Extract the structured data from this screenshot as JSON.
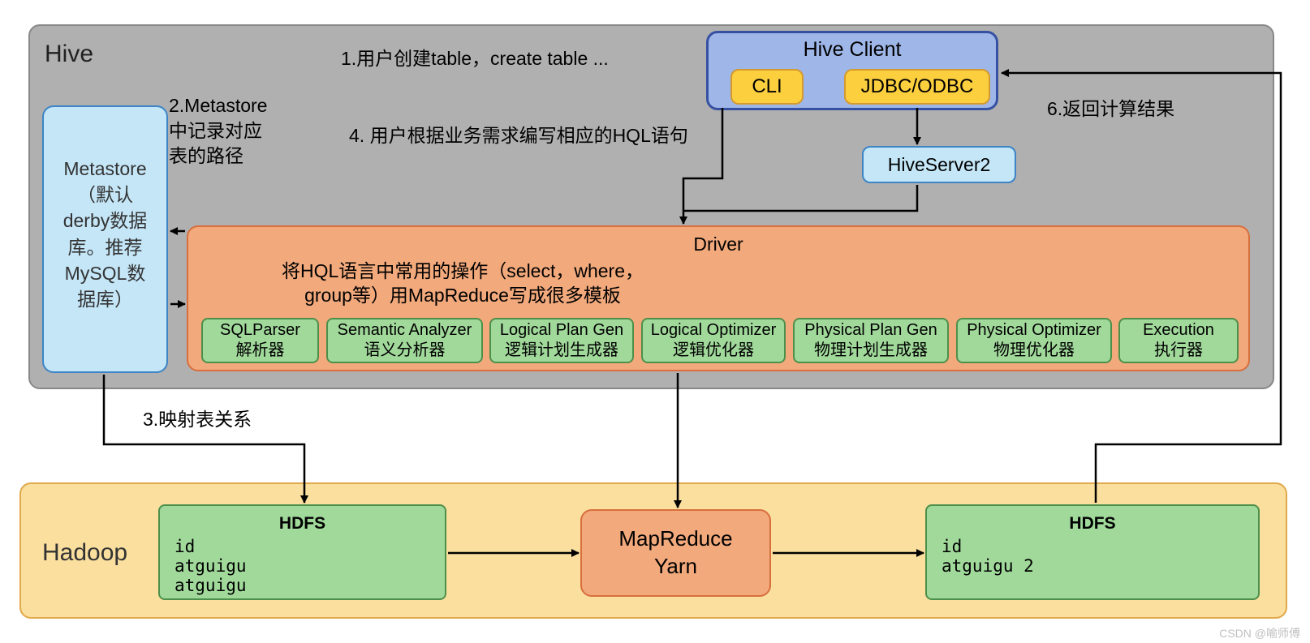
{
  "hive": {
    "title": "Hive",
    "step1": "1.用户创建table，create table ...",
    "step2_line1": "2.Metastore",
    "step2_line2": "中记录对应",
    "step2_line3": "表的路径",
    "step4": "4. 用户根据业务需求编写相应的HQL语句",
    "step6": "6.返回计算结果",
    "step3": "3.映射表关系"
  },
  "metastore": {
    "line1": "Metastore",
    "line2": "（默认",
    "line3": "derby数据",
    "line4": "库。推荐",
    "line5": "MySQL数",
    "line6": "据库）"
  },
  "client": {
    "title": "Hive Client",
    "cli": "CLI",
    "jdbc": "JDBC/ODBC"
  },
  "hiveserver2": "HiveServer2",
  "driver": {
    "title": "Driver",
    "desc1": "将HQL语言中常用的操作（select，where，",
    "desc2": "group等）用MapReduce写成很多模板",
    "stages": {
      "s1a": "SQLParser",
      "s1b": "解析器",
      "s2a": "Semantic Analyzer",
      "s2b": "语义分析器",
      "s3a": "Logical Plan Gen",
      "s3b": "逻辑计划生成器",
      "s4a": "Logical Optimizer",
      "s4b": "逻辑优化器",
      "s5a": "Physical Plan Gen",
      "s5b": "物理计划生成器",
      "s6a": "Physical Optimizer",
      "s6b": "物理优化器",
      "s7a": "Execution",
      "s7b": "执行器"
    }
  },
  "hadoop": {
    "title": "Hadoop",
    "hdfs_left_title": "HDFS",
    "hdfs_left_r1": "id",
    "hdfs_left_r2": "atguigu",
    "hdfs_left_r3": "atguigu",
    "mapreduce_l1": "MapReduce",
    "mapreduce_l2": "Yarn",
    "hdfs_right_title": "HDFS",
    "hdfs_right_r1": "id",
    "hdfs_right_r2": "atguigu 2"
  },
  "watermark": "CSDN @喻师傅"
}
